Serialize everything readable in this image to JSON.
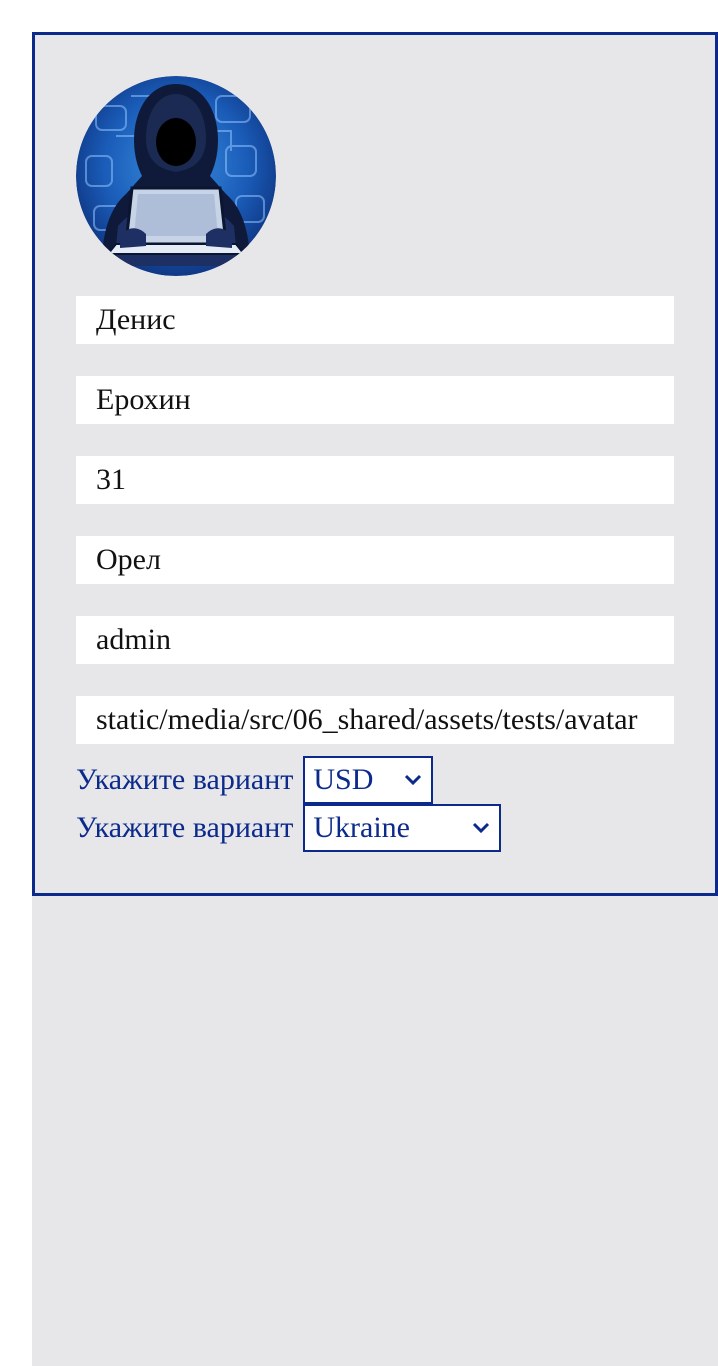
{
  "profile": {
    "first_name": "Денис",
    "last_name": "Ерохин",
    "age": "31",
    "city": "Орел",
    "role": "admin",
    "avatar_path": "static/media/src/06_shared/assets/tests/avatar"
  },
  "selects": {
    "currency": {
      "label": "Укажите вариант",
      "value": "USD"
    },
    "country": {
      "label": "Укажите вариант",
      "value": "Ukraine"
    }
  },
  "colors": {
    "accent": "#0b2a8c",
    "card_background": "#e7e7ea",
    "field_background": "#ffffff"
  },
  "icons": {
    "avatar": "hooded-hacker-avatar",
    "select": "chevron-down-icon"
  }
}
